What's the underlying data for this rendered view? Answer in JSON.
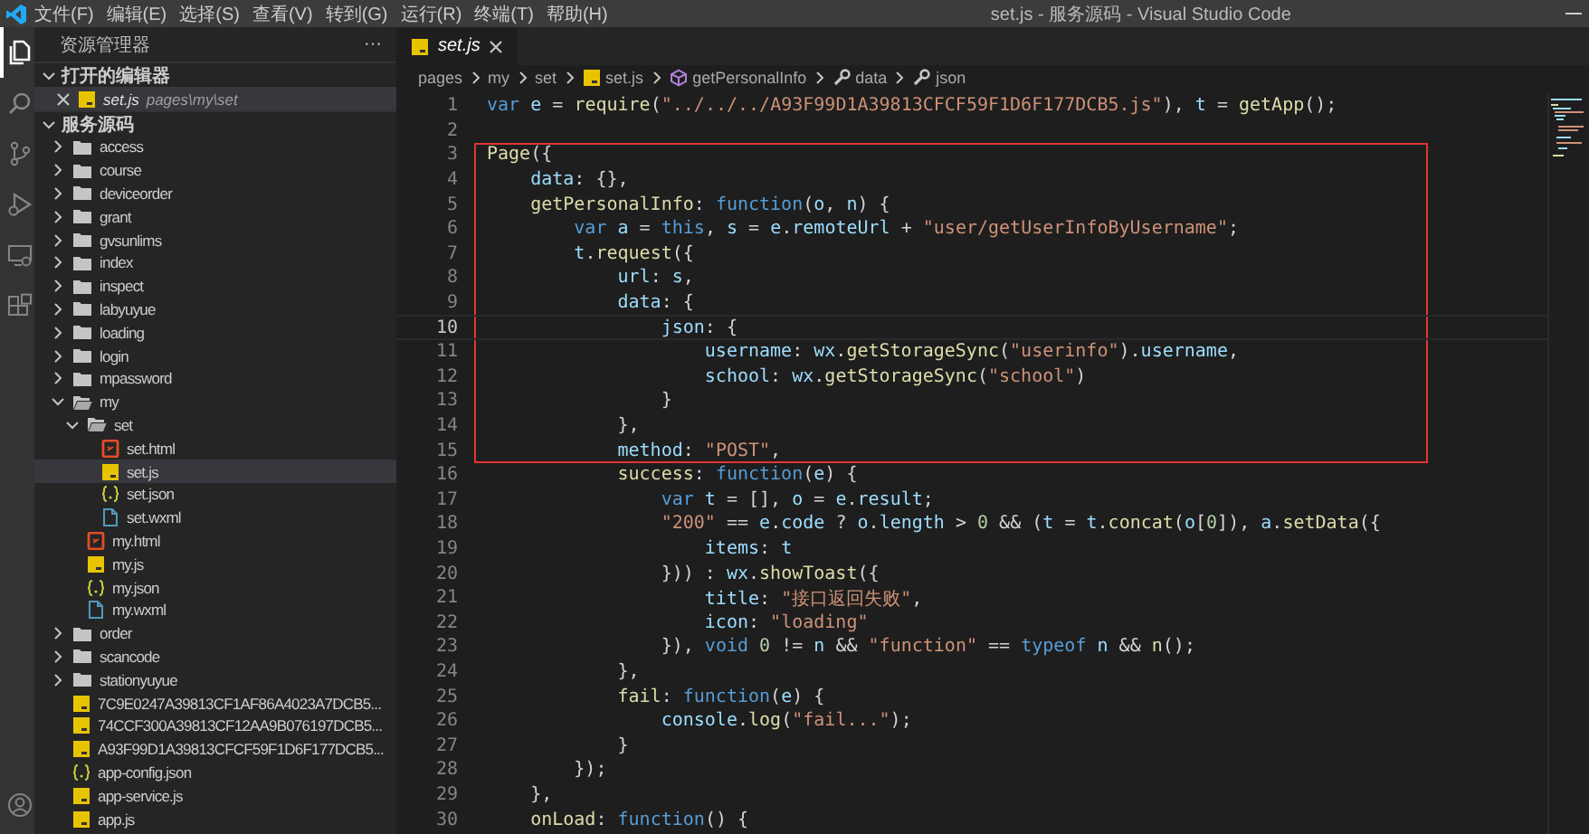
{
  "window": {
    "menu": [
      "文件(F)",
      "编辑(E)",
      "选择(S)",
      "查看(V)",
      "转到(G)",
      "运行(R)",
      "终端(T)",
      "帮助(H)"
    ],
    "title": "set.js - 服务源码 - Visual Studio Code"
  },
  "activity_bar": [
    {
      "selected": true
    },
    {
      "selected": false
    },
    {
      "selected": false
    },
    {
      "selected": false
    },
    {
      "selected": false
    },
    {
      "selected": false
    }
  ],
  "sidebar": {
    "title": "资源管理器",
    "more": "···",
    "open_editors": {
      "title": "打开的编辑器",
      "expanded": true,
      "items": [
        {
          "name": "set.js",
          "path": "pages\\my\\set",
          "kind": "js"
        }
      ]
    },
    "folder": {
      "title": "服务源码",
      "expanded": true,
      "items": [
        {
          "label": "access",
          "kind": "folder",
          "expanded": false,
          "selected": false
        },
        {
          "label": "course",
          "kind": "folder",
          "expanded": false,
          "selected": false
        },
        {
          "label": "deviceorder",
          "kind": "folder",
          "expanded": false,
          "selected": false
        },
        {
          "label": "grant",
          "kind": "folder",
          "expanded": false,
          "selected": false
        },
        {
          "label": "gvsunlims",
          "kind": "folder",
          "expanded": false,
          "selected": false
        },
        {
          "label": "index",
          "kind": "folder",
          "expanded": false,
          "selected": false
        },
        {
          "label": "inspect",
          "kind": "folder",
          "expanded": false,
          "selected": false
        },
        {
          "label": "labyuyue",
          "kind": "folder",
          "expanded": false,
          "selected": false
        },
        {
          "label": "loading",
          "kind": "folder",
          "expanded": false,
          "selected": false
        },
        {
          "label": "login",
          "kind": "folder",
          "expanded": false,
          "selected": false
        },
        {
          "label": "mpassword",
          "kind": "folder",
          "expanded": false,
          "selected": false
        },
        {
          "label": "my",
          "kind": "folder",
          "expanded": true,
          "selected": false,
          "children": [
            {
              "label": "set",
              "kind": "folder",
              "expanded": true,
              "selected": false,
              "children": [
                {
                  "label": "set.html",
                  "kind": "html",
                  "selected": false
                },
                {
                  "label": "set.js",
                  "kind": "js",
                  "selected": true
                },
                {
                  "label": "set.json",
                  "kind": "json",
                  "selected": false
                },
                {
                  "label": "set.wxml",
                  "kind": "wxml",
                  "selected": false
                }
              ]
            },
            {
              "label": "my.html",
              "kind": "html",
              "selected": false
            },
            {
              "label": "my.js",
              "kind": "js",
              "selected": false
            },
            {
              "label": "my.json",
              "kind": "json",
              "selected": false
            },
            {
              "label": "my.wxml",
              "kind": "wxml",
              "selected": false
            }
          ]
        },
        {
          "label": "order",
          "kind": "folder",
          "expanded": false,
          "selected": false
        },
        {
          "label": "scancode",
          "kind": "folder",
          "expanded": false,
          "selected": false
        },
        {
          "label": "stationyuyue",
          "kind": "folder",
          "expanded": false,
          "selected": false
        },
        {
          "label": "7C9E0247A39813CF1AF86A4023A7DCB5...",
          "kind": "js",
          "selected": false
        },
        {
          "label": "74CCF300A39813CF12AA9B076197DCB5...",
          "kind": "js",
          "selected": false
        },
        {
          "label": "A93F99D1A39813CFCF59F1D6F177DCB5...",
          "kind": "js",
          "selected": false
        },
        {
          "label": "app-config.json",
          "kind": "json",
          "selected": false
        },
        {
          "label": "app-service.js",
          "kind": "js",
          "selected": false
        },
        {
          "label": "app.js",
          "kind": "js",
          "selected": false
        }
      ]
    }
  },
  "editor": {
    "tabs": [
      {
        "label": "set.js",
        "kind": "js",
        "selected": true
      }
    ],
    "breadcrumbs": [
      {
        "label": "pages",
        "kind": "text"
      },
      {
        "label": "my",
        "kind": "text"
      },
      {
        "label": "set",
        "kind": "text"
      },
      {
        "label": "set.js",
        "kind": "js"
      },
      {
        "label": "getPersonalInfo",
        "kind": "method"
      },
      {
        "label": "data",
        "kind": "property"
      },
      {
        "label": "json",
        "kind": "property"
      }
    ],
    "lines": [
      {
        "number": "1",
        "current": false,
        "highlighted": false,
        "tokens": [
          {
            "text": "var ",
            "kind": "keyword"
          },
          {
            "text": "e",
            "kind": "variable"
          },
          {
            "text": " = ",
            "kind": "plain"
          },
          {
            "text": "require",
            "kind": "function"
          },
          {
            "text": "(",
            "kind": "plain"
          },
          {
            "text": "\"../../../A93F99D1A39813CFCF59F1D6F177DCB5.js\"",
            "kind": "string"
          },
          {
            "text": "), ",
            "kind": "plain"
          },
          {
            "text": "t",
            "kind": "variable"
          },
          {
            "text": " = ",
            "kind": "plain"
          },
          {
            "text": "getApp",
            "kind": "function"
          },
          {
            "text": "();",
            "kind": "plain"
          }
        ]
      },
      {
        "number": "2",
        "current": false,
        "highlighted": false
      },
      {
        "number": "3",
        "current": false,
        "highlighted": true,
        "tokens": [
          {
            "text": "Page",
            "kind": "function"
          },
          {
            "text": "({",
            "kind": "plain"
          }
        ]
      },
      {
        "number": "4",
        "current": false,
        "highlighted": true,
        "tokens": [
          {
            "text": "    data",
            "kind": "variable"
          },
          {
            "text": ": {},",
            "kind": "plain"
          }
        ]
      },
      {
        "number": "5",
        "current": false,
        "highlighted": true,
        "tokens": [
          {
            "text": "    getPersonalInfo",
            "kind": "function"
          },
          {
            "text": ": ",
            "kind": "plain"
          },
          {
            "text": "function",
            "kind": "keyword"
          },
          {
            "text": "(",
            "kind": "plain"
          },
          {
            "text": "o",
            "kind": "variable"
          },
          {
            "text": ", ",
            "kind": "plain"
          },
          {
            "text": "n",
            "kind": "variable"
          },
          {
            "text": ") {",
            "kind": "plain"
          }
        ]
      },
      {
        "number": "6",
        "current": false,
        "highlighted": true,
        "tokens": [
          {
            "text": "        var ",
            "kind": "keyword"
          },
          {
            "text": "a",
            "kind": "variable"
          },
          {
            "text": " = ",
            "kind": "plain"
          },
          {
            "text": "this",
            "kind": "keyword"
          },
          {
            "text": ", ",
            "kind": "plain"
          },
          {
            "text": "s",
            "kind": "variable"
          },
          {
            "text": " = ",
            "kind": "plain"
          },
          {
            "text": "e",
            "kind": "variable"
          },
          {
            "text": ".",
            "kind": "plain"
          },
          {
            "text": "remoteUrl",
            "kind": "variable"
          },
          {
            "text": " + ",
            "kind": "plain"
          },
          {
            "text": "\"user/getUserInfoByUsername\"",
            "kind": "string"
          },
          {
            "text": ";",
            "kind": "plain"
          }
        ]
      },
      {
        "number": "7",
        "current": false,
        "highlighted": true,
        "tokens": [
          {
            "text": "        t",
            "kind": "variable"
          },
          {
            "text": ".",
            "kind": "plain"
          },
          {
            "text": "request",
            "kind": "function"
          },
          {
            "text": "({",
            "kind": "plain"
          }
        ]
      },
      {
        "number": "8",
        "current": false,
        "highlighted": true,
        "tokens": [
          {
            "text": "            url",
            "kind": "variable"
          },
          {
            "text": ": ",
            "kind": "plain"
          },
          {
            "text": "s",
            "kind": "variable"
          },
          {
            "text": ",",
            "kind": "plain"
          }
        ]
      },
      {
        "number": "9",
        "current": false,
        "highlighted": true,
        "tokens": [
          {
            "text": "            data",
            "kind": "variable"
          },
          {
            "text": ": {",
            "kind": "plain"
          }
        ]
      },
      {
        "number": "10",
        "current": true,
        "highlighted": true,
        "tokens": [
          {
            "text": "                json",
            "kind": "variable"
          },
          {
            "text": ": {",
            "kind": "plain"
          }
        ]
      },
      {
        "number": "11",
        "current": false,
        "highlighted": true,
        "tokens": [
          {
            "text": "                    username",
            "kind": "variable"
          },
          {
            "text": ": ",
            "kind": "plain"
          },
          {
            "text": "wx",
            "kind": "variable"
          },
          {
            "text": ".",
            "kind": "plain"
          },
          {
            "text": "getStorageSync",
            "kind": "function"
          },
          {
            "text": "(",
            "kind": "plain"
          },
          {
            "text": "\"userinfo\"",
            "kind": "string"
          },
          {
            "text": ").",
            "kind": "plain"
          },
          {
            "text": "username",
            "kind": "variable"
          },
          {
            "text": ",",
            "kind": "plain"
          }
        ]
      },
      {
        "number": "12",
        "current": false,
        "highlighted": true,
        "tokens": [
          {
            "text": "                    school",
            "kind": "variable"
          },
          {
            "text": ": ",
            "kind": "plain"
          },
          {
            "text": "wx",
            "kind": "variable"
          },
          {
            "text": ".",
            "kind": "plain"
          },
          {
            "text": "getStorageSync",
            "kind": "function"
          },
          {
            "text": "(",
            "kind": "plain"
          },
          {
            "text": "\"school\"",
            "kind": "string"
          },
          {
            "text": ")",
            "kind": "plain"
          }
        ]
      },
      {
        "number": "13",
        "current": false,
        "highlighted": true,
        "tokens": [
          {
            "text": "                }",
            "kind": "plain"
          }
        ]
      },
      {
        "number": "14",
        "current": false,
        "highlighted": true,
        "tokens": [
          {
            "text": "            },",
            "kind": "plain"
          }
        ]
      },
      {
        "number": "15",
        "current": false,
        "highlighted": true,
        "tokens": [
          {
            "text": "            method",
            "kind": "variable"
          },
          {
            "text": ": ",
            "kind": "plain"
          },
          {
            "text": "\"POST\"",
            "kind": "string"
          },
          {
            "text": ",",
            "kind": "plain"
          }
        ]
      },
      {
        "number": "16",
        "current": false,
        "highlighted": false,
        "tokens": [
          {
            "text": "            success",
            "kind": "function"
          },
          {
            "text": ": ",
            "kind": "plain"
          },
          {
            "text": "function",
            "kind": "keyword"
          },
          {
            "text": "(",
            "kind": "plain"
          },
          {
            "text": "e",
            "kind": "variable"
          },
          {
            "text": ") {",
            "kind": "plain"
          }
        ]
      },
      {
        "number": "17",
        "current": false,
        "highlighted": false,
        "tokens": [
          {
            "text": "                var ",
            "kind": "keyword"
          },
          {
            "text": "t",
            "kind": "variable"
          },
          {
            "text": " = [], ",
            "kind": "plain"
          },
          {
            "text": "o",
            "kind": "variable"
          },
          {
            "text": " = ",
            "kind": "plain"
          },
          {
            "text": "e",
            "kind": "variable"
          },
          {
            "text": ".",
            "kind": "plain"
          },
          {
            "text": "result",
            "kind": "variable"
          },
          {
            "text": ";",
            "kind": "plain"
          }
        ]
      },
      {
        "number": "18",
        "current": false,
        "highlighted": false,
        "tokens": [
          {
            "text": "                \"200\"",
            "kind": "string"
          },
          {
            "text": " == ",
            "kind": "plain"
          },
          {
            "text": "e",
            "kind": "variable"
          },
          {
            "text": ".",
            "kind": "plain"
          },
          {
            "text": "code",
            "kind": "variable"
          },
          {
            "text": " ? ",
            "kind": "plain"
          },
          {
            "text": "o",
            "kind": "variable"
          },
          {
            "text": ".",
            "kind": "plain"
          },
          {
            "text": "length",
            "kind": "variable"
          },
          {
            "text": " > ",
            "kind": "plain"
          },
          {
            "text": "0",
            "kind": "number"
          },
          {
            "text": " && (",
            "kind": "plain"
          },
          {
            "text": "t",
            "kind": "variable"
          },
          {
            "text": " = ",
            "kind": "plain"
          },
          {
            "text": "t",
            "kind": "variable"
          },
          {
            "text": ".",
            "kind": "plain"
          },
          {
            "text": "concat",
            "kind": "function"
          },
          {
            "text": "(",
            "kind": "plain"
          },
          {
            "text": "o",
            "kind": "variable"
          },
          {
            "text": "[",
            "kind": "plain"
          },
          {
            "text": "0",
            "kind": "number"
          },
          {
            "text": "]), ",
            "kind": "plain"
          },
          {
            "text": "a",
            "kind": "variable"
          },
          {
            "text": ".",
            "kind": "plain"
          },
          {
            "text": "setData",
            "kind": "function"
          },
          {
            "text": "({",
            "kind": "plain"
          }
        ]
      },
      {
        "number": "19",
        "current": false,
        "highlighted": false,
        "tokens": [
          {
            "text": "                    items",
            "kind": "variable"
          },
          {
            "text": ": ",
            "kind": "plain"
          },
          {
            "text": "t",
            "kind": "variable"
          }
        ]
      },
      {
        "number": "20",
        "current": false,
        "highlighted": false,
        "tokens": [
          {
            "text": "                })) : ",
            "kind": "plain"
          },
          {
            "text": "wx",
            "kind": "variable"
          },
          {
            "text": ".",
            "kind": "plain"
          },
          {
            "text": "showToast",
            "kind": "function"
          },
          {
            "text": "({",
            "kind": "plain"
          }
        ]
      },
      {
        "number": "21",
        "current": false,
        "highlighted": false,
        "tokens": [
          {
            "text": "                    title",
            "kind": "variable"
          },
          {
            "text": ": ",
            "kind": "plain"
          },
          {
            "text": "\"接口返回失败\"",
            "kind": "string"
          },
          {
            "text": ",",
            "kind": "plain"
          }
        ]
      },
      {
        "number": "22",
        "current": false,
        "highlighted": false,
        "tokens": [
          {
            "text": "                    icon",
            "kind": "variable"
          },
          {
            "text": ": ",
            "kind": "plain"
          },
          {
            "text": "\"loading\"",
            "kind": "string"
          }
        ]
      },
      {
        "number": "23",
        "current": false,
        "highlighted": false,
        "tokens": [
          {
            "text": "                }), ",
            "kind": "plain"
          },
          {
            "text": "void ",
            "kind": "keyword"
          },
          {
            "text": "0",
            "kind": "number"
          },
          {
            "text": " != ",
            "kind": "plain"
          },
          {
            "text": "n",
            "kind": "variable"
          },
          {
            "text": " && ",
            "kind": "plain"
          },
          {
            "text": "\"function\"",
            "kind": "string"
          },
          {
            "text": " == ",
            "kind": "plain"
          },
          {
            "text": "typeof ",
            "kind": "keyword"
          },
          {
            "text": "n",
            "kind": "variable"
          },
          {
            "text": " && ",
            "kind": "plain"
          },
          {
            "text": "n",
            "kind": "function"
          },
          {
            "text": "();",
            "kind": "plain"
          }
        ]
      },
      {
        "number": "24",
        "current": false,
        "highlighted": false,
        "tokens": [
          {
            "text": "            },",
            "kind": "plain"
          }
        ]
      },
      {
        "number": "25",
        "current": false,
        "highlighted": false,
        "tokens": [
          {
            "text": "            fail",
            "kind": "function"
          },
          {
            "text": ": ",
            "kind": "plain"
          },
          {
            "text": "function",
            "kind": "keyword"
          },
          {
            "text": "(",
            "kind": "plain"
          },
          {
            "text": "e",
            "kind": "variable"
          },
          {
            "text": ") {",
            "kind": "plain"
          }
        ]
      },
      {
        "number": "26",
        "current": false,
        "highlighted": false,
        "tokens": [
          {
            "text": "                console",
            "kind": "variable"
          },
          {
            "text": ".",
            "kind": "plain"
          },
          {
            "text": "log",
            "kind": "function"
          },
          {
            "text": "(",
            "kind": "plain"
          },
          {
            "text": "\"fail...\"",
            "kind": "string"
          },
          {
            "text": ");",
            "kind": "plain"
          }
        ]
      },
      {
        "number": "27",
        "current": false,
        "highlighted": false,
        "tokens": [
          {
            "text": "            }",
            "kind": "plain"
          }
        ]
      },
      {
        "number": "28",
        "current": false,
        "highlighted": false,
        "tokens": [
          {
            "text": "        });",
            "kind": "plain"
          }
        ]
      },
      {
        "number": "29",
        "current": false,
        "highlighted": false,
        "tokens": [
          {
            "text": "    },",
            "kind": "plain"
          }
        ]
      },
      {
        "number": "30",
        "current": false,
        "highlighted": false,
        "tokens": [
          {
            "text": "    onLoad",
            "kind": "function"
          },
          {
            "text": ": ",
            "kind": "plain"
          },
          {
            "text": "function",
            "kind": "keyword"
          },
          {
            "text": "() {",
            "kind": "plain"
          }
        ]
      }
    ]
  }
}
